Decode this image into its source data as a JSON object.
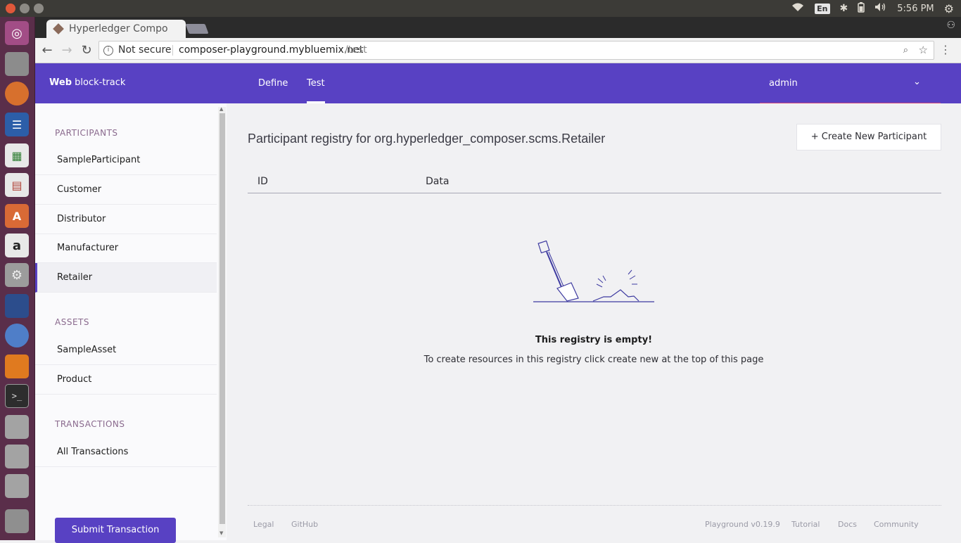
{
  "browser": {
    "tab_title": "Hyperledger Compo",
    "security_label": "Not secure",
    "url_host": "composer-playground.mybluemix.net",
    "url_path": "/test"
  },
  "system": {
    "lang": "En",
    "clock": "5:56 PM"
  },
  "header": {
    "brand_bold": "Web",
    "brand_name": "block-track",
    "tabs": [
      {
        "label": "Define"
      },
      {
        "label": "Test"
      }
    ],
    "user": "admin"
  },
  "sidebar": {
    "participants_title": "PARTICIPANTS",
    "participants": [
      {
        "label": "SampleParticipant"
      },
      {
        "label": "Customer"
      },
      {
        "label": "Distributor"
      },
      {
        "label": "Manufacturer"
      },
      {
        "label": "Retailer"
      }
    ],
    "assets_title": "ASSETS",
    "assets": [
      {
        "label": "SampleAsset"
      },
      {
        "label": "Product"
      }
    ],
    "transactions_title": "TRANSACTIONS",
    "transactions": [
      {
        "label": "All Transactions"
      }
    ],
    "submit_label": "Submit Transaction"
  },
  "main": {
    "title": "Participant registry for org.hyperledger_composer.scms.Retailer",
    "create_label": "+ Create New Participant",
    "columns": [
      "ID",
      "Data"
    ],
    "empty_title": "This registry is empty!",
    "empty_subtitle": "To create resources in this registry click create new at the top of this page"
  },
  "footer": {
    "legal": "Legal",
    "github": "GitHub",
    "version": "Playground v0.19.9",
    "tutorial": "Tutorial",
    "docs": "Docs",
    "community": "Community"
  },
  "colors": {
    "accent": "#5841c3",
    "launcher": "#5a2e4a"
  }
}
